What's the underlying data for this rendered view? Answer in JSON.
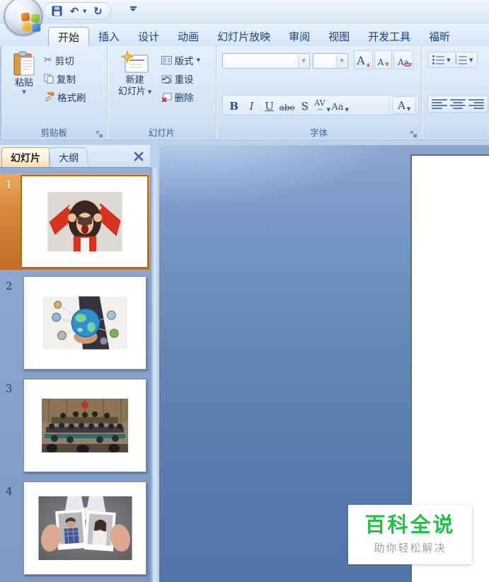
{
  "tabs": [
    {
      "label": "开始",
      "active": true
    },
    {
      "label": "插入",
      "active": false
    },
    {
      "label": "设计",
      "active": false
    },
    {
      "label": "动画",
      "active": false
    },
    {
      "label": "幻灯片放映",
      "active": false
    },
    {
      "label": "审阅",
      "active": false
    },
    {
      "label": "视图",
      "active": false
    },
    {
      "label": "开发工具",
      "active": false
    },
    {
      "label": "福昕",
      "active": false
    }
  ],
  "ribbon": {
    "clipboard": {
      "group_label": "剪贴板",
      "paste": "粘贴",
      "cut": "剪切",
      "copy": "复制",
      "format_painter": "格式刷"
    },
    "slides": {
      "group_label": "幻灯片",
      "new_slide_line1": "新建",
      "new_slide_line2": "幻灯片",
      "layout": "版式",
      "reset": "重设",
      "delete": "删除"
    },
    "font": {
      "group_label": "字体",
      "grow": "A",
      "shrink": "A",
      "clear": "Aa",
      "bold": "B",
      "italic": "I",
      "underline": "U",
      "strikethrough": "abe",
      "shadow": "S",
      "char_spacing": "AV",
      "change_case": "Aa",
      "font_color": "A"
    },
    "paragraph": {
      "group_label": ""
    }
  },
  "slides_panel": {
    "tab_slides": "幻灯片",
    "tab_outline": "大纲",
    "slides": [
      {
        "number": "1",
        "selected": true,
        "photo": "screaming-woman-in-red"
      },
      {
        "number": "2",
        "selected": false,
        "photo": "hand-holding-globe-network"
      },
      {
        "number": "3",
        "selected": false,
        "photo": "courtroom-session"
      },
      {
        "number": "4",
        "selected": false,
        "photo": "hands-holding-torn-couple-photos"
      }
    ]
  },
  "watermark": {
    "title": "百科全说",
    "subtitle": "助你轻松解决",
    "title_color": "#21c146"
  },
  "icons": {
    "qat": [
      "save-icon",
      "undo-icon",
      "redo-icon",
      "customize-qat-icon"
    ],
    "undo_glyph": "↶",
    "redo_glyph": "↻",
    "cut_glyph": "✂"
  }
}
